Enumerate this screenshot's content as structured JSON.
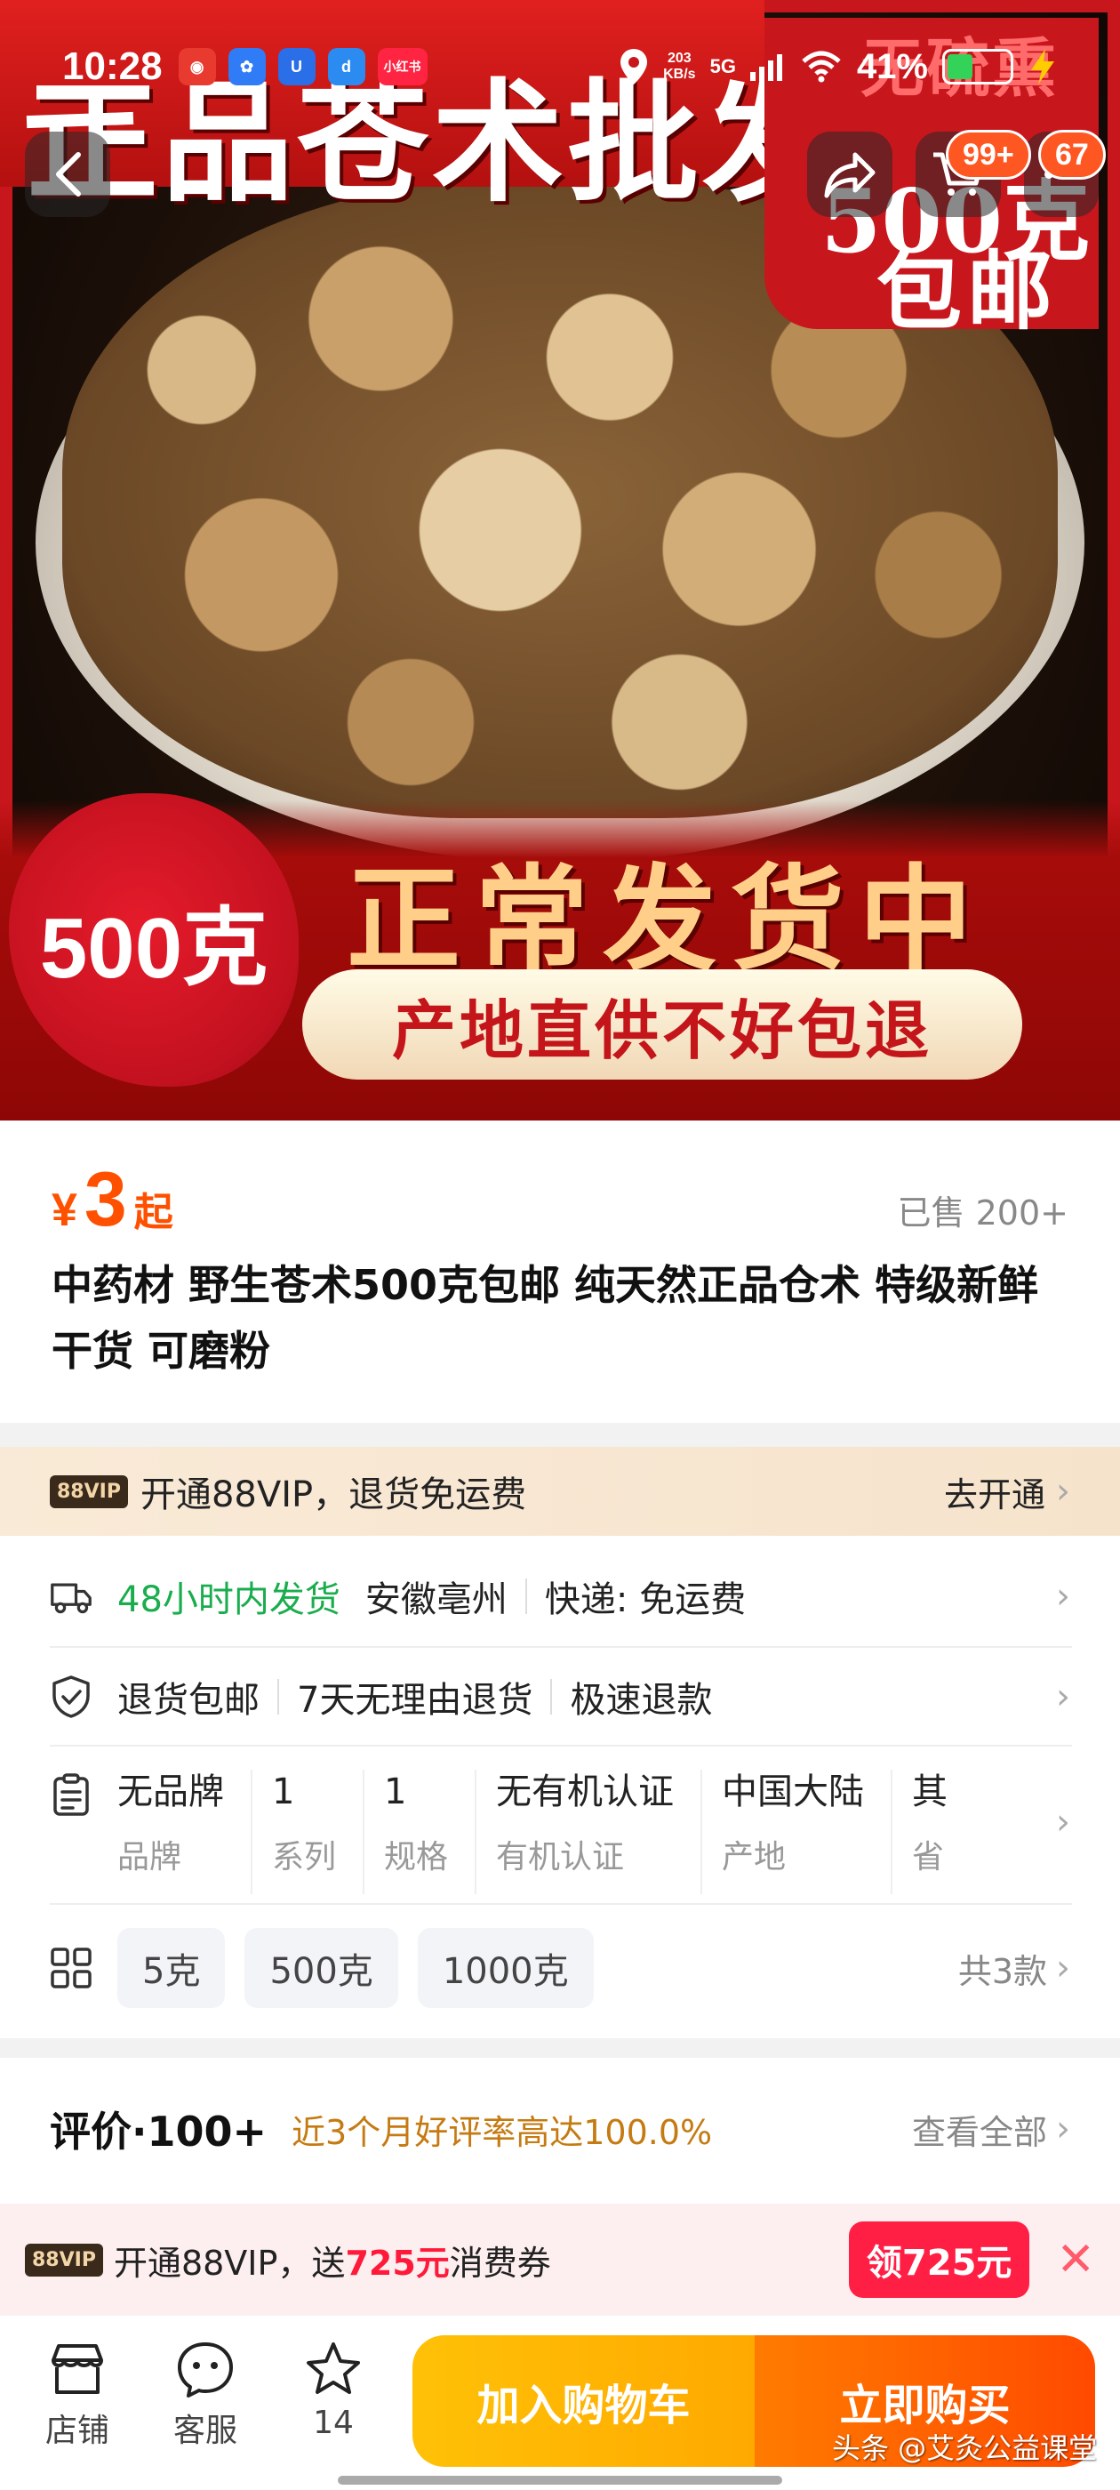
{
  "status_bar": {
    "time": "10:28",
    "net_speed": "203",
    "net_unit": "KB/s",
    "signal": "5G",
    "battery": "41%"
  },
  "hero": {
    "top_text": "正品苍术批发",
    "corner_watermark": "无硫熏",
    "corner_price": "500克",
    "corner_free": "包邮",
    "weight": "500克",
    "shipping": "正常发货中",
    "pill": "产地直供不好包退"
  },
  "overlay": {
    "badge_cart": "99+",
    "badge_msg": "67"
  },
  "product": {
    "currency": "¥",
    "price": "3",
    "price_suffix": "起",
    "sold": "已售 200+",
    "title": "中药材 野生苍术500克包邮 纯天然正品仓术 特级新鲜干货 可磨粉"
  },
  "vip_bar": {
    "tag": "88VIP",
    "text": "开通88VIP，退货免运费",
    "action": "去开通"
  },
  "shipping_row": {
    "time": "48小时内发货",
    "origin": "安徽亳州",
    "express": "快递: 免运费"
  },
  "service_row": {
    "items": [
      "退货包邮",
      "7天无理由退货",
      "极速退款"
    ]
  },
  "attributes": [
    {
      "value": "无品牌",
      "key": "品牌"
    },
    {
      "value": "1",
      "key": "系列"
    },
    {
      "value": "1",
      "key": "规格"
    },
    {
      "value": "无有机认证",
      "key": "有机认证"
    },
    {
      "value": "中国大陆",
      "key": "产地"
    },
    {
      "value": "其",
      "key": "省"
    }
  ],
  "sku": {
    "options": [
      "5克",
      "500克",
      "1000克"
    ],
    "total": "共3款"
  },
  "reviews": {
    "title": "评价·100+",
    "rate": "近3个月好评率高达100.0%",
    "view_all": "查看全部"
  },
  "promo": {
    "tag": "88VIP",
    "text_prefix": "开通88VIP，送",
    "amount": "725元",
    "text_suffix": "消费券",
    "button": "领725元"
  },
  "bottom_bar": {
    "store": "店铺",
    "service": "客服",
    "fav_count": "14",
    "add_cart": "加入购物车",
    "buy_now": "立即购买"
  },
  "watermark": "头条 @艾灸公益课堂"
}
